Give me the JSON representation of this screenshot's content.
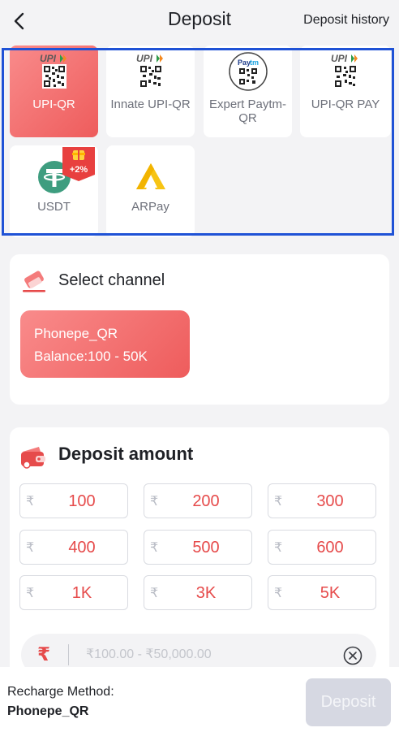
{
  "header": {
    "title": "Deposit",
    "history_link": "Deposit history"
  },
  "methods": [
    {
      "label": "UPI-QR",
      "selected": true,
      "icon": "upi-qr-icon"
    },
    {
      "label": "Innate UPI-QR",
      "selected": false,
      "icon": "upi-qr-icon"
    },
    {
      "label": "Expert Paytm-QR",
      "selected": false,
      "icon": "paytm-qr-icon"
    },
    {
      "label": "UPI-QR PAY",
      "selected": false,
      "icon": "upi-qr-icon"
    },
    {
      "label": "USDT",
      "selected": false,
      "icon": "tether-icon",
      "badge": "+2%"
    },
    {
      "label": "ARPay",
      "selected": false,
      "icon": "arpay-logo-icon"
    }
  ],
  "channel": {
    "title": "Select channel",
    "options": [
      {
        "name": "Phonepe_QR",
        "balance": "Balance:100 - 50K",
        "selected": true
      }
    ]
  },
  "amount": {
    "title": "Deposit amount",
    "currency_symbol": "₹",
    "presets": [
      "100",
      "200",
      "300",
      "400",
      "500",
      "600",
      "1K",
      "3K",
      "5K"
    ],
    "input": {
      "value": "",
      "placeholder": "₹100.00 - ₹50,000.00"
    }
  },
  "footer": {
    "method_label": "Recharge Method:",
    "method_value": "Phonepe_QR",
    "deposit_button": "Deposit"
  },
  "colors": {
    "accent": "#e64b4b",
    "highlight_border": "#1f52d6",
    "disabled_button": "#d6d8e2"
  }
}
